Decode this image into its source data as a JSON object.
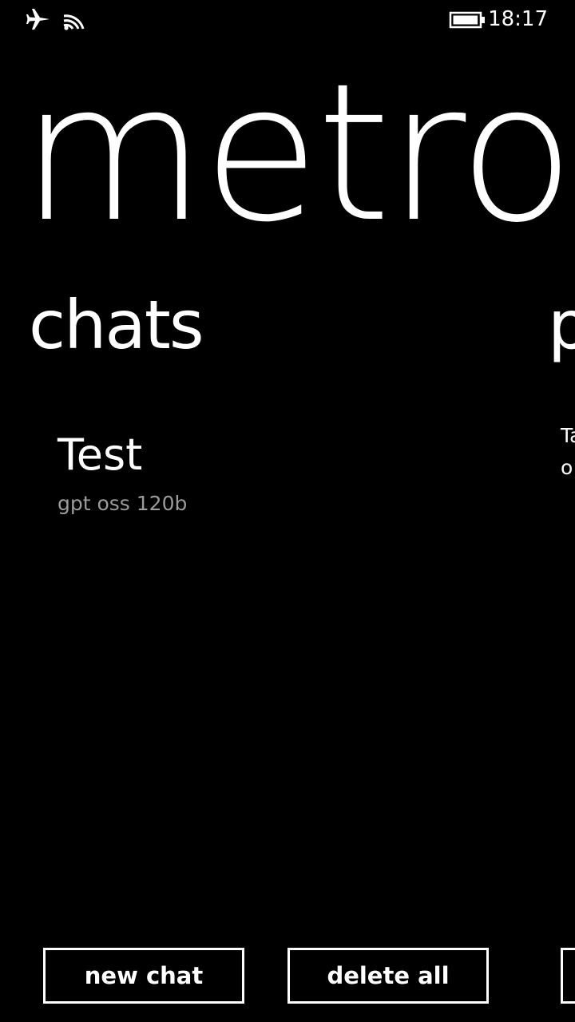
{
  "status_bar": {
    "airplane_icon": "airplane-icon",
    "wifi_icon": "wifi-icon",
    "battery_icon": "battery-icon",
    "battery_level": 0.9,
    "time": "18:17"
  },
  "app": {
    "title": "metroc"
  },
  "sections": {
    "chats_header": "chats",
    "next_header": "p"
  },
  "chats": [
    {
      "title": "Test",
      "subtitle": "gpt oss 120b"
    }
  ],
  "next_section": {
    "peek_line_1": "Ta",
    "peek_line_2": "o"
  },
  "buttons": {
    "new_chat": "new chat",
    "delete_all": "delete all",
    "peek": ""
  },
  "colors": {
    "background": "#000000",
    "foreground": "#ffffff",
    "secondary_text": "#9b9b9b"
  }
}
